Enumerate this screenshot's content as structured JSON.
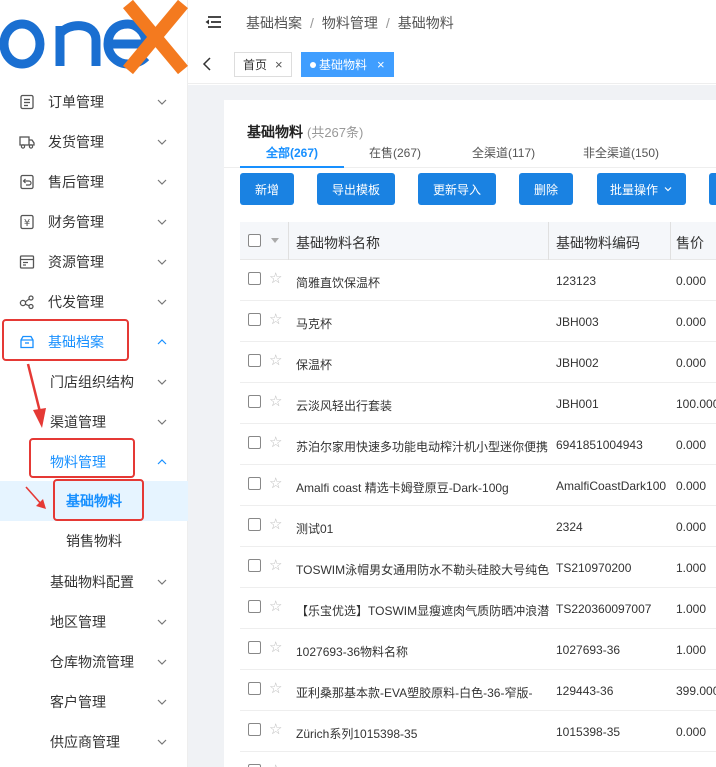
{
  "logo": {
    "text": "ONEX",
    "brand_color": "#1a6fd1",
    "accent_color": "#f47a1f"
  },
  "sidebar": {
    "items": [
      {
        "label": "订单管理",
        "icon": "order-icon"
      },
      {
        "label": "发货管理",
        "icon": "truck-icon"
      },
      {
        "label": "售后管理",
        "icon": "return-icon"
      },
      {
        "label": "财务管理",
        "icon": "yen-icon"
      },
      {
        "label": "资源管理",
        "icon": "resource-icon"
      },
      {
        "label": "代发管理",
        "icon": "share-icon"
      },
      {
        "label": "基础档案",
        "icon": "archive-icon"
      },
      {
        "label": "门店组织结构"
      },
      {
        "label": "渠道管理"
      },
      {
        "label": "物料管理"
      },
      {
        "label": "基础物料"
      },
      {
        "label": "销售物料"
      },
      {
        "label": "基础物料配置"
      },
      {
        "label": "地区管理"
      },
      {
        "label": "仓库物流管理"
      },
      {
        "label": "客户管理"
      },
      {
        "label": "供应商管理"
      }
    ]
  },
  "breadcrumb": [
    "基础档案",
    "物料管理",
    "基础物料"
  ],
  "tabs": [
    {
      "label": "首页"
    },
    {
      "label": "基础物料"
    }
  ],
  "page": {
    "title": "基础物料",
    "count": "(共267条)",
    "subtabs": [
      "全部(267)",
      "在售(267)",
      "全渠道(117)",
      "非全渠道(150)"
    ],
    "buttons": [
      "新增",
      "导出模板",
      "更新导入",
      "删除",
      "批量操作"
    ]
  },
  "table": {
    "headers": [
      "基础物料名称",
      "基础物料编码",
      "售价"
    ],
    "rows": [
      {
        "name": "简雅直饮保温杯",
        "code": "123123",
        "price": "0.000"
      },
      {
        "name": "马克杯",
        "code": "JBH003",
        "price": "0.000"
      },
      {
        "name": "保温杯",
        "code": "JBH002",
        "price": "0.000"
      },
      {
        "name": "云淡风轻出行套装",
        "code": "JBH001",
        "price": "100.000"
      },
      {
        "name": "苏泊尔家用快速多功能电动榨汁机小型迷你便携",
        "code": "6941851004943",
        "price": "0.000"
      },
      {
        "name": "Amalfi coast 精选卡姆登原豆-Dark-100g",
        "code": "AmalfiCoastDark100",
        "price": "0.000"
      },
      {
        "name": "测试01",
        "code": "2324",
        "price": "0.000"
      },
      {
        "name": "TOSWIM泳帽男女通用防水不勒头硅胶大号纯色",
        "code": "TS210970200",
        "price": "1.000"
      },
      {
        "name": "【乐宝优选】TOSWIM显瘦遮肉气质防晒冲浪潜",
        "code": "TS220360097007",
        "price": "1.000"
      },
      {
        "name": "1027693-36物料名称",
        "code": "1027693-36",
        "price": "1.000"
      },
      {
        "name": "亚利桑那基本款-EVA塑胶原料-白色-36-窄版-",
        "code": "129443-36",
        "price": "399.000"
      },
      {
        "name": "Zürich系列1015398-35",
        "code": "1015398-35",
        "price": "0.000"
      },
      {
        "name": "",
        "code": "",
        "price": ""
      }
    ]
  }
}
